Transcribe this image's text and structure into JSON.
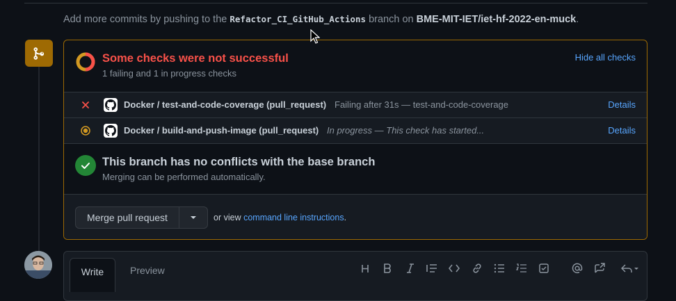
{
  "push_note": {
    "prefix": "Add more commits by pushing to the",
    "branch": "Refactor_CI_GitHub_Actions",
    "middle": "branch on",
    "repo": "BME-MIT-IET/iet-hf-2022-en-muck",
    "suffix": "."
  },
  "checks": {
    "title": "Some checks were not successful",
    "subtitle": "1 failing and 1 in progress checks",
    "hide_link": "Hide all checks",
    "rows": [
      {
        "name": "Docker / test-and-code-coverage (pull_request)",
        "description": "Failing after 31s — test-and-code-coverage",
        "details": "Details",
        "status": "failing"
      },
      {
        "name": "Docker / build-and-push-image (pull_request)",
        "description": "In progress — This check has started...",
        "details": "Details",
        "status": "in-progress"
      }
    ]
  },
  "conflicts": {
    "title": "This branch has no conflicts with the base branch",
    "subtitle": "Merging can be performed automatically."
  },
  "merge": {
    "button_label": "Merge pull request",
    "or_view": "or view",
    "cli_link": "command line instructions",
    "period": "."
  },
  "comment": {
    "tab_write": "Write",
    "tab_preview": "Preview",
    "toolbar_icons": [
      "heading-icon",
      "bold-icon",
      "italic-icon",
      "quote-icon",
      "code-icon",
      "link-icon",
      "bulleted-list-icon",
      "numbered-list-icon",
      "task-list-icon",
      "mention-icon",
      "cross-reference-icon",
      "reply-icon"
    ]
  },
  "colors": {
    "background": "#0d1117",
    "accent_link": "#58a6ff",
    "failure": "#f85149",
    "success": "#238636",
    "pending": "#d29922",
    "merge_badge": "#9e6a03"
  }
}
